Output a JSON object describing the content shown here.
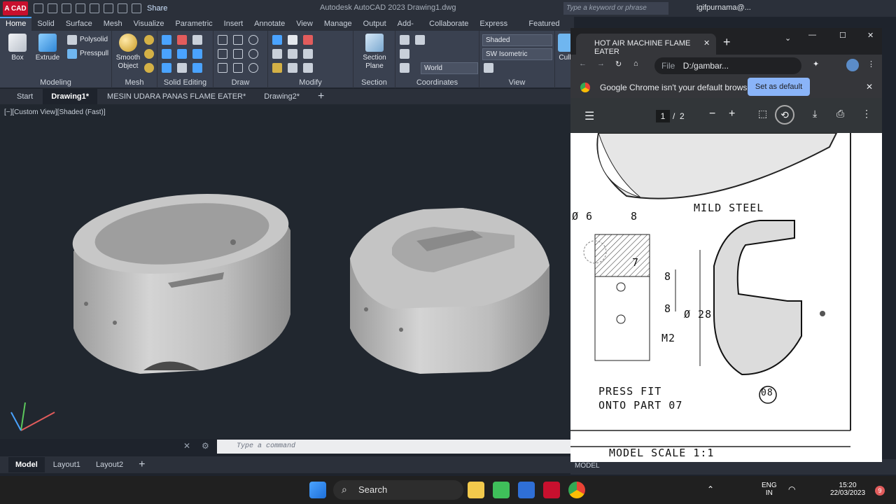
{
  "app": {
    "logo": "A CAD",
    "title": "Autodesk AutoCAD 2023   Drawing1.dwg",
    "share": "Share",
    "search_placeholder": "Type a keyword or phrase",
    "user": "igifpurnama@..."
  },
  "ribbon_tabs": [
    "Home",
    "Solid",
    "Surface",
    "Mesh",
    "Visualize",
    "Parametric",
    "Insert",
    "Annotate",
    "View",
    "Manage",
    "Output",
    "Add-ins",
    "Collaborate",
    "Express Tools",
    "Featured Apps"
  ],
  "ribbon": {
    "box": "Box",
    "extrude": "Extrude",
    "polysolid": "Polysolid",
    "presspull": "Presspull",
    "smooth": "Smooth Object",
    "section": "Section Plane",
    "style": "Shaded",
    "view": "SW Isometric",
    "ucs": "World",
    "cull": "Cull",
    "groups": [
      "Modeling",
      "Mesh",
      "Solid Editing",
      "Draw",
      "Modify",
      "Section",
      "Coordinates",
      "View"
    ]
  },
  "doc_tabs": [
    "Start",
    "Drawing1*",
    "MESIN UDARA PANAS FLAME EATER*",
    "Drawing2*"
  ],
  "viewport_label": "[−][Custom View][Shaded (Fast)]",
  "command_placeholder": "Type a command",
  "layout_tabs": [
    "Model",
    "Layout1",
    "Layout2"
  ],
  "status": {
    "model": "MODEL"
  },
  "chrome": {
    "tab_title": "HOT AIR MACHINE FLAME EATER",
    "address_file": "File",
    "address": "D:/gambar...",
    "infobar_text": "Google Chrome isn't your default browser",
    "set_default": "Set as default",
    "page_current": "1",
    "page_sep": "/",
    "page_total": "2"
  },
  "drawing": {
    "dim_phi6": "Ø 6",
    "dim_8a": "8",
    "dim_7": "7",
    "dim_8b": "8",
    "dim_8c": "8",
    "dim_phi28": "Ø 28",
    "m2": "M2",
    "material": "MILD STEEL",
    "note1": "PRESS FIT",
    "note2": "ONTO PART 07",
    "part": "08",
    "scale": "MODEL SCALE 1:1"
  },
  "taskbar": {
    "search": "Search",
    "lang1": "ENG",
    "lang2": "IN",
    "time": "15:20",
    "date": "22/03/2023",
    "notif": "9"
  }
}
